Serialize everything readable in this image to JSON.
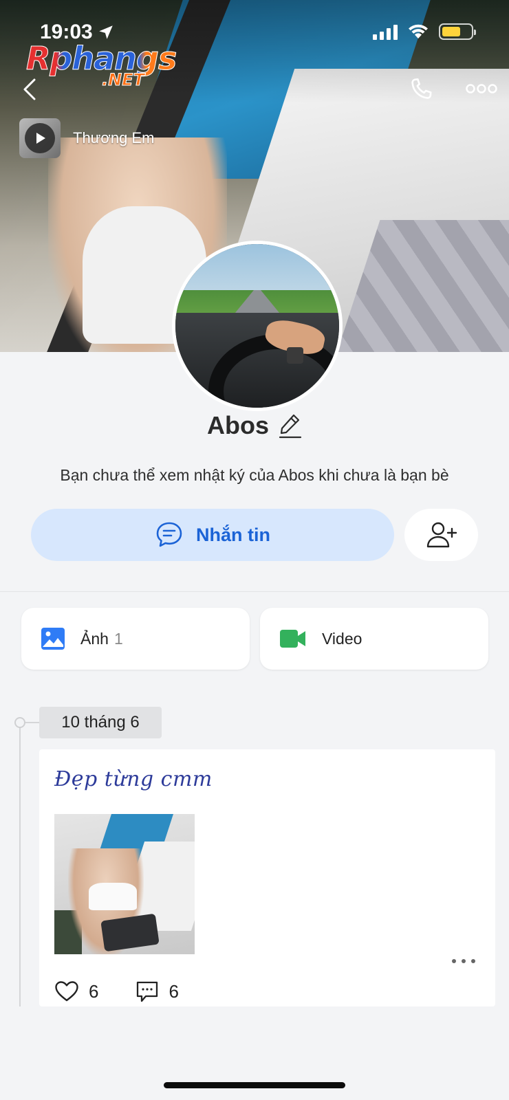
{
  "status_bar": {
    "time": "19:03"
  },
  "watermark": {
    "brand": "Rphangs",
    "suffix": ".NET"
  },
  "music": {
    "title": "Thương Em"
  },
  "profile": {
    "name": "Abos",
    "notice": "Bạn chưa thể xem nhật ký của Abos khi chưa là bạn bè"
  },
  "actions": {
    "message_label": "Nhắn tin"
  },
  "media": {
    "photos_label": "Ảnh",
    "photos_count": "1",
    "video_label": "Video"
  },
  "timeline": {
    "date": "10 tháng 6"
  },
  "post": {
    "caption": "Đẹp từng cmm",
    "likes": "6",
    "comments": "6"
  },
  "colors": {
    "accent": "#1b63d6",
    "accent_soft": "#d7e7fd",
    "photo_icon": "#2f7cf6",
    "video_icon": "#33b15c",
    "caption": "#2d3b9a"
  },
  "icons": {
    "back": "chevron-left-icon",
    "call": "phone-icon",
    "more": "more-horizontal-icon",
    "play": "play-icon",
    "edit": "pencil-icon",
    "chat": "chat-bubble-icon",
    "add_friend": "user-plus-icon",
    "photos": "image-icon",
    "video": "video-camera-icon",
    "like": "heart-icon",
    "comment": "comment-icon"
  }
}
